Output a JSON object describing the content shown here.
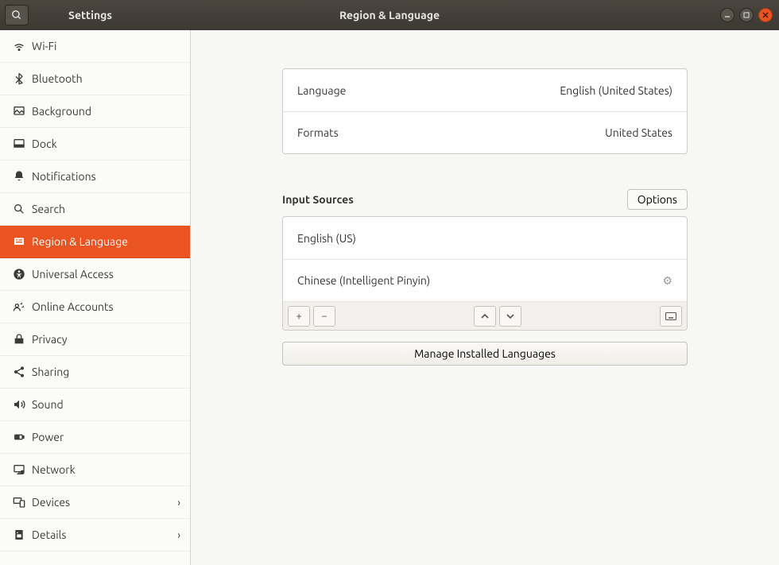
{
  "titlebar": {
    "app_title": "Settings",
    "page_title": "Region & Language"
  },
  "sidebar": {
    "items": [
      {
        "label": "Wi-Fi",
        "icon": "wifi"
      },
      {
        "label": "Bluetooth",
        "icon": "bluetooth"
      },
      {
        "label": "Background",
        "icon": "background"
      },
      {
        "label": "Dock",
        "icon": "dock"
      },
      {
        "label": "Notifications",
        "icon": "bell"
      },
      {
        "label": "Search",
        "icon": "search"
      },
      {
        "label": "Region & Language",
        "icon": "region",
        "active": true
      },
      {
        "label": "Universal Access",
        "icon": "accessibility"
      },
      {
        "label": "Online Accounts",
        "icon": "accounts"
      },
      {
        "label": "Privacy",
        "icon": "privacy"
      },
      {
        "label": "Sharing",
        "icon": "sharing"
      },
      {
        "label": "Sound",
        "icon": "sound"
      },
      {
        "label": "Power",
        "icon": "power"
      },
      {
        "label": "Network",
        "icon": "network"
      },
      {
        "label": "Devices",
        "icon": "devices",
        "chevron": true
      },
      {
        "label": "Details",
        "icon": "details",
        "chevron": true
      }
    ]
  },
  "main": {
    "language_label": "Language",
    "language_value": "English (United States)",
    "formats_label": "Formats",
    "formats_value": "United States",
    "input_sources_title": "Input Sources",
    "options_label": "Options",
    "sources": [
      {
        "name": "English (US)",
        "has_gear": false
      },
      {
        "name": "Chinese (Intelligent Pinyin)",
        "has_gear": true
      }
    ],
    "manage_label": "Manage Installed Languages"
  }
}
